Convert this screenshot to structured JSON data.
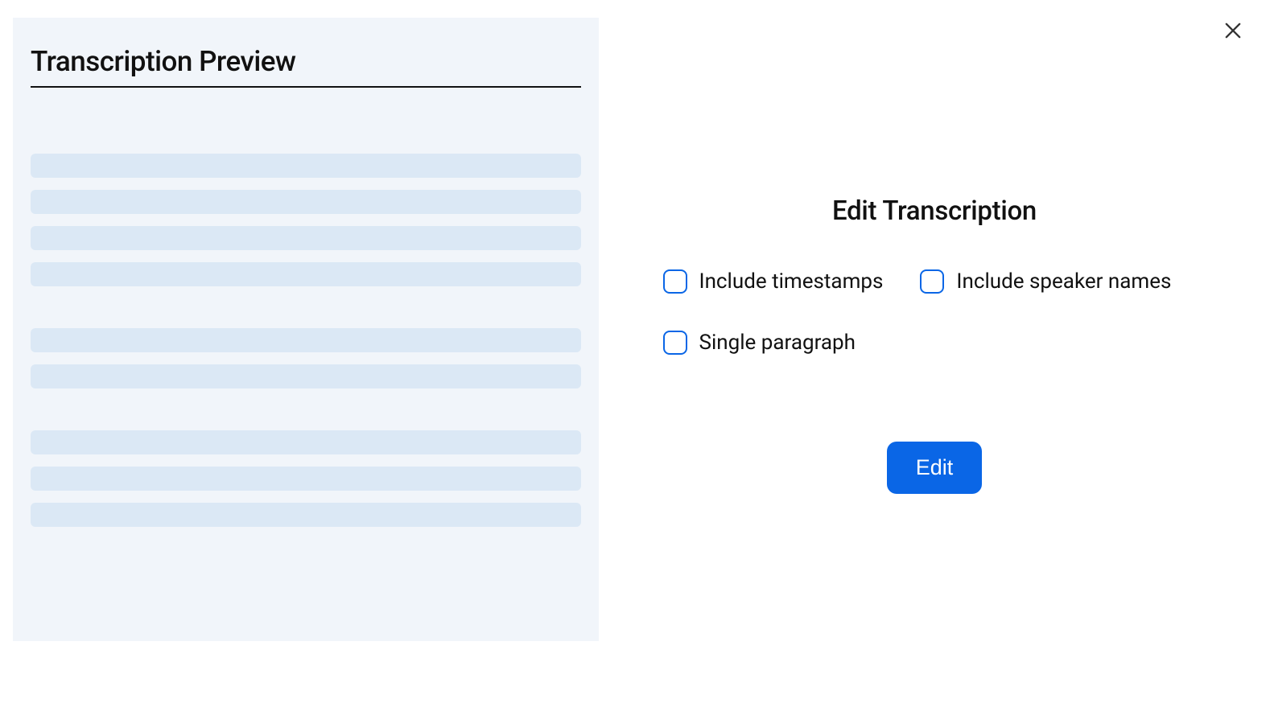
{
  "preview": {
    "title": "Transcription Preview"
  },
  "editor": {
    "heading": "Edit Transcription",
    "options": {
      "timestamps": "Include timestamps",
      "speaker_names": "Include speaker names",
      "single_paragraph": "Single paragraph"
    },
    "button_label": "Edit"
  }
}
